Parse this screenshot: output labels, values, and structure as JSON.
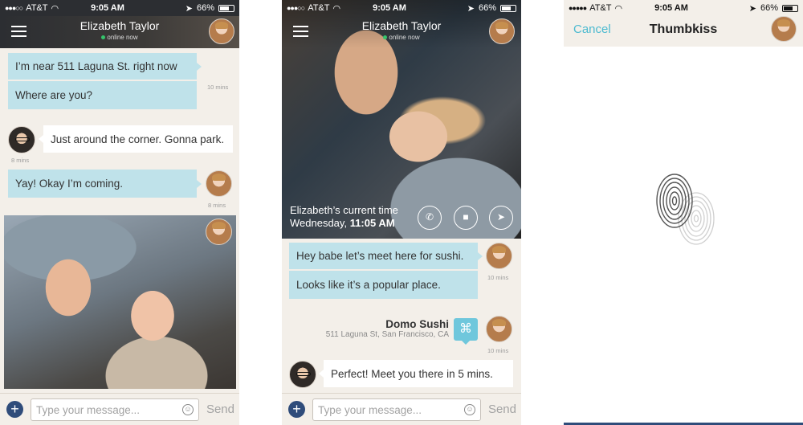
{
  "status": {
    "carrier": "AT&T",
    "time": "9:05 AM",
    "battery": "66%"
  },
  "chat": {
    "contact_name": "Elizabeth Taylor",
    "presence": "online now",
    "composer": {
      "placeholder": "Type your message...",
      "send_label": "Send",
      "plus": "+",
      "smile": "☺"
    }
  },
  "screen1": {
    "messages": [
      {
        "text": "I’m near 511 Laguna St. right now"
      },
      {
        "text": "Where are you?"
      },
      {
        "text": "Just around the corner. Gonna park."
      },
      {
        "text": "Yay! Okay I’m coming."
      }
    ],
    "stamps": [
      "10 mins",
      "8 mins",
      "8 mins"
    ]
  },
  "screen2": {
    "current_time_label": "Elizabeth’s current time",
    "current_day": "Wednesday,",
    "current_clock": "11:05 AM",
    "messages": [
      {
        "text": "Hey babe let’s meet here for sushi."
      },
      {
        "text": "Looks like it’s a popular place."
      },
      {
        "text": "Perfect! Meet you there in 5 mins."
      }
    ],
    "place": {
      "name": "Domo Sushi",
      "address": "511 Laguna St, San Francisco, CA"
    },
    "stamps": [
      "10 mins",
      "10 mins"
    ]
  },
  "screen3": {
    "cancel_label": "Cancel",
    "title": "Thumbkiss"
  }
}
